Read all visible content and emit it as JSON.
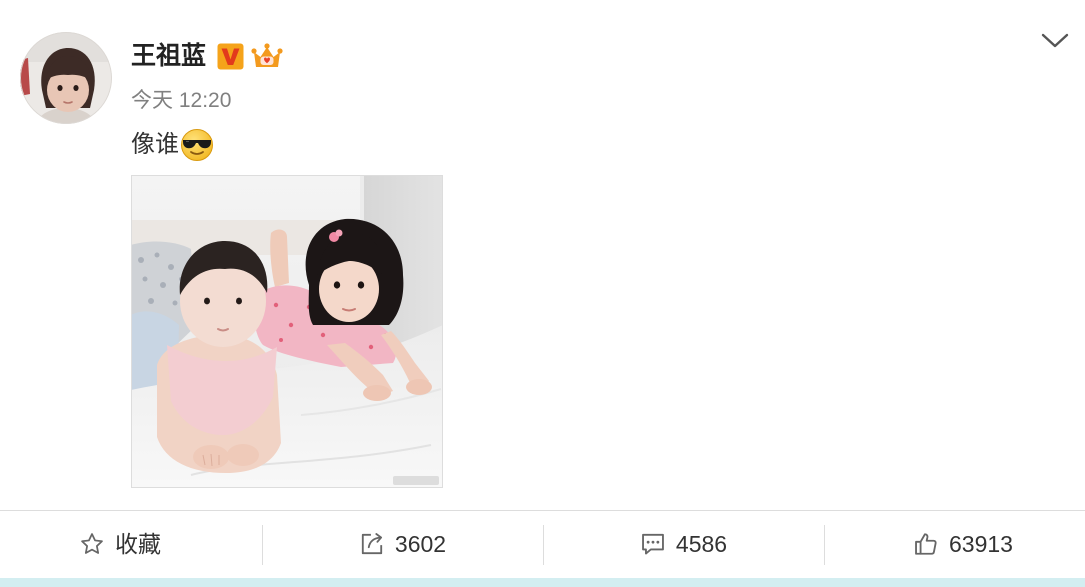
{
  "post": {
    "author": {
      "name": "王祖蓝",
      "verified_icon": "verified-v-icon",
      "member_icon": "crown-icon"
    },
    "time": "今天 12:20",
    "text": "像谁",
    "emoji_icon": "sunglasses-emoji-icon",
    "menu_icon": "chevron-down-icon"
  },
  "actions": [
    {
      "icon": "star-icon",
      "label": "收藏"
    },
    {
      "icon": "share-icon",
      "label": "3602"
    },
    {
      "icon": "comment-icon",
      "label": "4586"
    },
    {
      "icon": "thumbs-up-icon",
      "label": "63913"
    }
  ],
  "colors": {
    "name_text": "#222222",
    "time_text": "#808080",
    "body_text": "#333333",
    "action_text": "#333333",
    "icon_stroke": "#666666",
    "divider": "#dddddd",
    "bottom_strip": "#d3eef1",
    "v_badge": "#f5a31a",
    "crown": "#f39a1e"
  }
}
